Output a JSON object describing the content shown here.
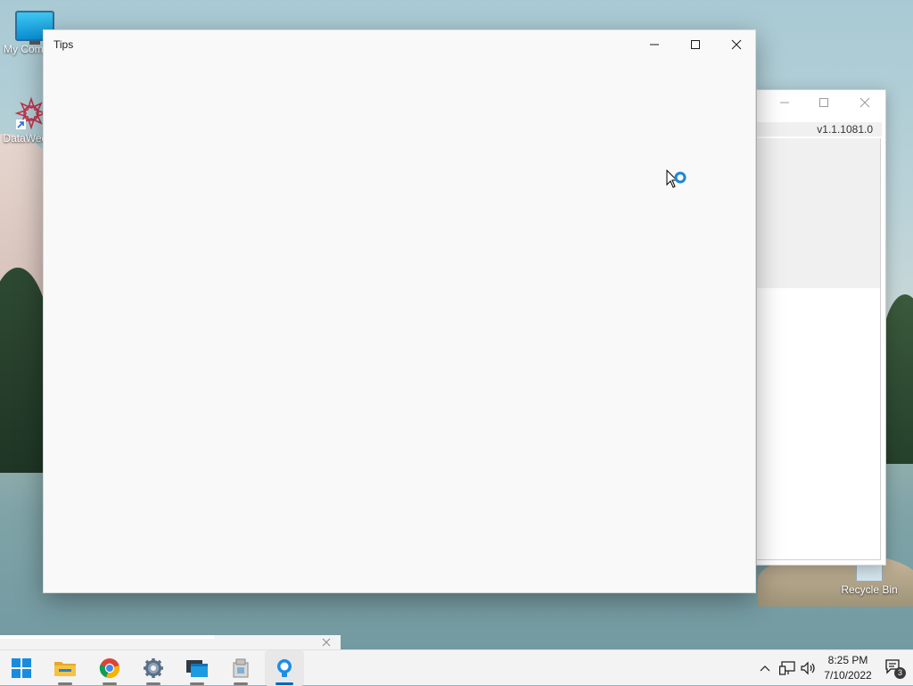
{
  "desktop": {
    "icons": [
      {
        "label": "My Computer",
        "icon": "monitor-icon"
      },
      {
        "label": "DataWedge",
        "icon": "datawedge-icon"
      },
      {
        "label": "Recycle Bin",
        "icon": "recycle-bin-icon"
      }
    ]
  },
  "background_window": {
    "version": "v1.1.1081.0"
  },
  "tips_window": {
    "title": "Tips"
  },
  "taskbar": {
    "items": [
      {
        "name": "start",
        "icon": "windows-logo-icon"
      },
      {
        "name": "file-explorer",
        "icon": "folder-icon"
      },
      {
        "name": "chrome",
        "icon": "chrome-icon"
      },
      {
        "name": "settings",
        "icon": "gear-icon"
      },
      {
        "name": "task-view",
        "icon": "window-stack-icon"
      },
      {
        "name": "app",
        "icon": "app-package-icon"
      },
      {
        "name": "tips",
        "icon": "lightbulb-icon",
        "active": true
      }
    ],
    "clock": {
      "time": "8:25 PM",
      "date": "7/10/2022"
    },
    "notification_count": "3"
  },
  "colors": {
    "accent": "#0067c0",
    "window_bg": "#f9f9f9",
    "taskbar_bg": "#f3f3f3"
  }
}
